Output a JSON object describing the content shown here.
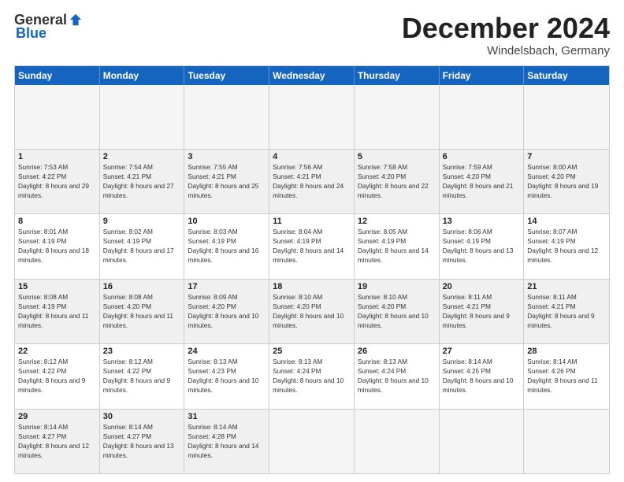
{
  "header": {
    "logo_general": "General",
    "logo_blue": "Blue",
    "month_title": "December 2024",
    "location": "Windelsbach, Germany"
  },
  "calendar": {
    "days_of_week": [
      "Sunday",
      "Monday",
      "Tuesday",
      "Wednesday",
      "Thursday",
      "Friday",
      "Saturday"
    ],
    "weeks": [
      [
        {
          "day": null
        },
        {
          "day": null
        },
        {
          "day": null
        },
        {
          "day": null
        },
        {
          "day": null
        },
        {
          "day": null
        },
        {
          "day": null
        }
      ],
      [
        {
          "day": 1,
          "sunrise": "7:53 AM",
          "sunset": "4:22 PM",
          "daylight": "8 hours and 29 minutes."
        },
        {
          "day": 2,
          "sunrise": "7:54 AM",
          "sunset": "4:21 PM",
          "daylight": "8 hours and 27 minutes."
        },
        {
          "day": 3,
          "sunrise": "7:55 AM",
          "sunset": "4:21 PM",
          "daylight": "8 hours and 25 minutes."
        },
        {
          "day": 4,
          "sunrise": "7:56 AM",
          "sunset": "4:21 PM",
          "daylight": "8 hours and 24 minutes."
        },
        {
          "day": 5,
          "sunrise": "7:58 AM",
          "sunset": "4:20 PM",
          "daylight": "8 hours and 22 minutes."
        },
        {
          "day": 6,
          "sunrise": "7:59 AM",
          "sunset": "4:20 PM",
          "daylight": "8 hours and 21 minutes."
        },
        {
          "day": 7,
          "sunrise": "8:00 AM",
          "sunset": "4:20 PM",
          "daylight": "8 hours and 19 minutes."
        }
      ],
      [
        {
          "day": 8,
          "sunrise": "8:01 AM",
          "sunset": "4:19 PM",
          "daylight": "8 hours and 18 minutes."
        },
        {
          "day": 9,
          "sunrise": "8:02 AM",
          "sunset": "4:19 PM",
          "daylight": "8 hours and 17 minutes."
        },
        {
          "day": 10,
          "sunrise": "8:03 AM",
          "sunset": "4:19 PM",
          "daylight": "8 hours and 16 minutes."
        },
        {
          "day": 11,
          "sunrise": "8:04 AM",
          "sunset": "4:19 PM",
          "daylight": "8 hours and 14 minutes."
        },
        {
          "day": 12,
          "sunrise": "8:05 AM",
          "sunset": "4:19 PM",
          "daylight": "8 hours and 14 minutes."
        },
        {
          "day": 13,
          "sunrise": "8:06 AM",
          "sunset": "4:19 PM",
          "daylight": "8 hours and 13 minutes."
        },
        {
          "day": 14,
          "sunrise": "8:07 AM",
          "sunset": "4:19 PM",
          "daylight": "8 hours and 12 minutes."
        }
      ],
      [
        {
          "day": 15,
          "sunrise": "8:08 AM",
          "sunset": "4:19 PM",
          "daylight": "8 hours and 11 minutes."
        },
        {
          "day": 16,
          "sunrise": "8:08 AM",
          "sunset": "4:20 PM",
          "daylight": "8 hours and 11 minutes."
        },
        {
          "day": 17,
          "sunrise": "8:09 AM",
          "sunset": "4:20 PM",
          "daylight": "8 hours and 10 minutes."
        },
        {
          "day": 18,
          "sunrise": "8:10 AM",
          "sunset": "4:20 PM",
          "daylight": "8 hours and 10 minutes."
        },
        {
          "day": 19,
          "sunrise": "8:10 AM",
          "sunset": "4:20 PM",
          "daylight": "8 hours and 10 minutes."
        },
        {
          "day": 20,
          "sunrise": "8:11 AM",
          "sunset": "4:21 PM",
          "daylight": "8 hours and 9 minutes."
        },
        {
          "day": 21,
          "sunrise": "8:11 AM",
          "sunset": "4:21 PM",
          "daylight": "8 hours and 9 minutes."
        }
      ],
      [
        {
          "day": 22,
          "sunrise": "8:12 AM",
          "sunset": "4:22 PM",
          "daylight": "8 hours and 9 minutes."
        },
        {
          "day": 23,
          "sunrise": "8:12 AM",
          "sunset": "4:22 PM",
          "daylight": "8 hours and 9 minutes."
        },
        {
          "day": 24,
          "sunrise": "8:13 AM",
          "sunset": "4:23 PM",
          "daylight": "8 hours and 10 minutes."
        },
        {
          "day": 25,
          "sunrise": "8:13 AM",
          "sunset": "4:24 PM",
          "daylight": "8 hours and 10 minutes."
        },
        {
          "day": 26,
          "sunrise": "8:13 AM",
          "sunset": "4:24 PM",
          "daylight": "8 hours and 10 minutes."
        },
        {
          "day": 27,
          "sunrise": "8:14 AM",
          "sunset": "4:25 PM",
          "daylight": "8 hours and 10 minutes."
        },
        {
          "day": 28,
          "sunrise": "8:14 AM",
          "sunset": "4:26 PM",
          "daylight": "8 hours and 11 minutes."
        }
      ],
      [
        {
          "day": 29,
          "sunrise": "8:14 AM",
          "sunset": "4:27 PM",
          "daylight": "8 hours and 12 minutes."
        },
        {
          "day": 30,
          "sunrise": "8:14 AM",
          "sunset": "4:27 PM",
          "daylight": "8 hours and 13 minutes."
        },
        {
          "day": 31,
          "sunrise": "8:14 AM",
          "sunset": "4:28 PM",
          "daylight": "8 hours and 14 minutes."
        },
        {
          "day": null
        },
        {
          "day": null
        },
        {
          "day": null
        },
        {
          "day": null
        }
      ]
    ]
  }
}
